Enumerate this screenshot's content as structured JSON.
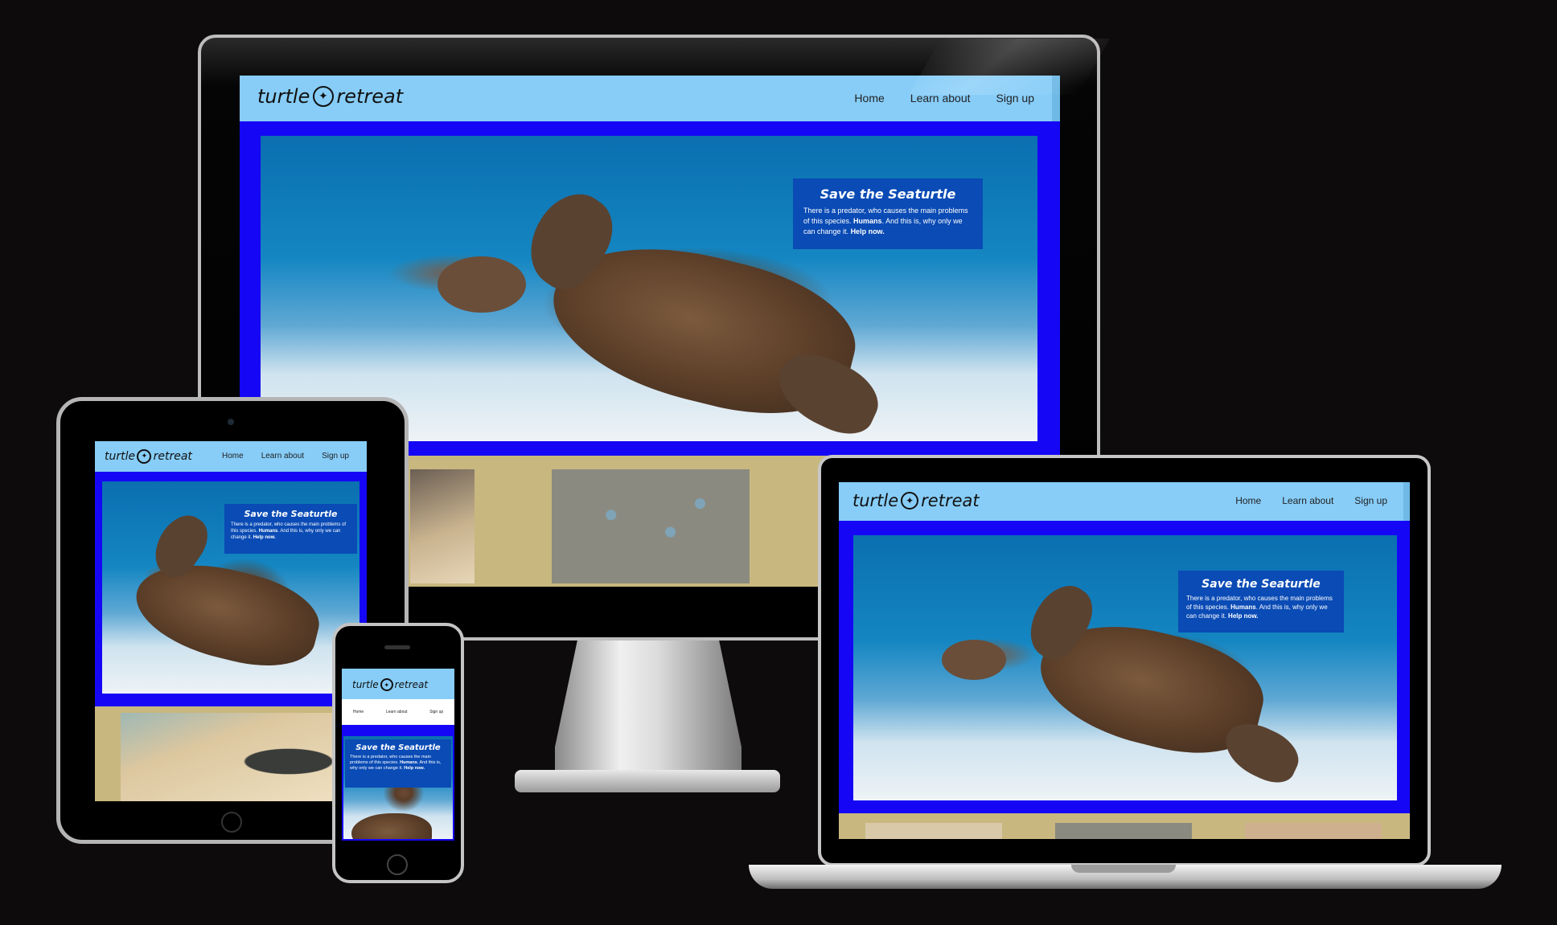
{
  "site": {
    "logo_left": "turtle",
    "logo_right": "retreat",
    "logo_icon": "turtle-icon",
    "nav": [
      "Home",
      "Learn about",
      "Sign up"
    ],
    "callout_title": "Save the Seaturtle",
    "callout_text_1": "There is a predator, who causes the main problems of this species.",
    "callout_bold_1": "Humans",
    "callout_text_2": ". And this is, why only we can change it.",
    "callout_bold_2": "Help now.",
    "phone_callout_text_1": "There is a predator, who causes the main problems of this species.",
    "phone_callout_text_2": ". And this is, why only we can change it."
  },
  "colors": {
    "header": "#87cdf8",
    "hero_border": "#1507f5",
    "callout_bg": "#0a4bb5",
    "gallery_bg": "#c8b77f"
  }
}
